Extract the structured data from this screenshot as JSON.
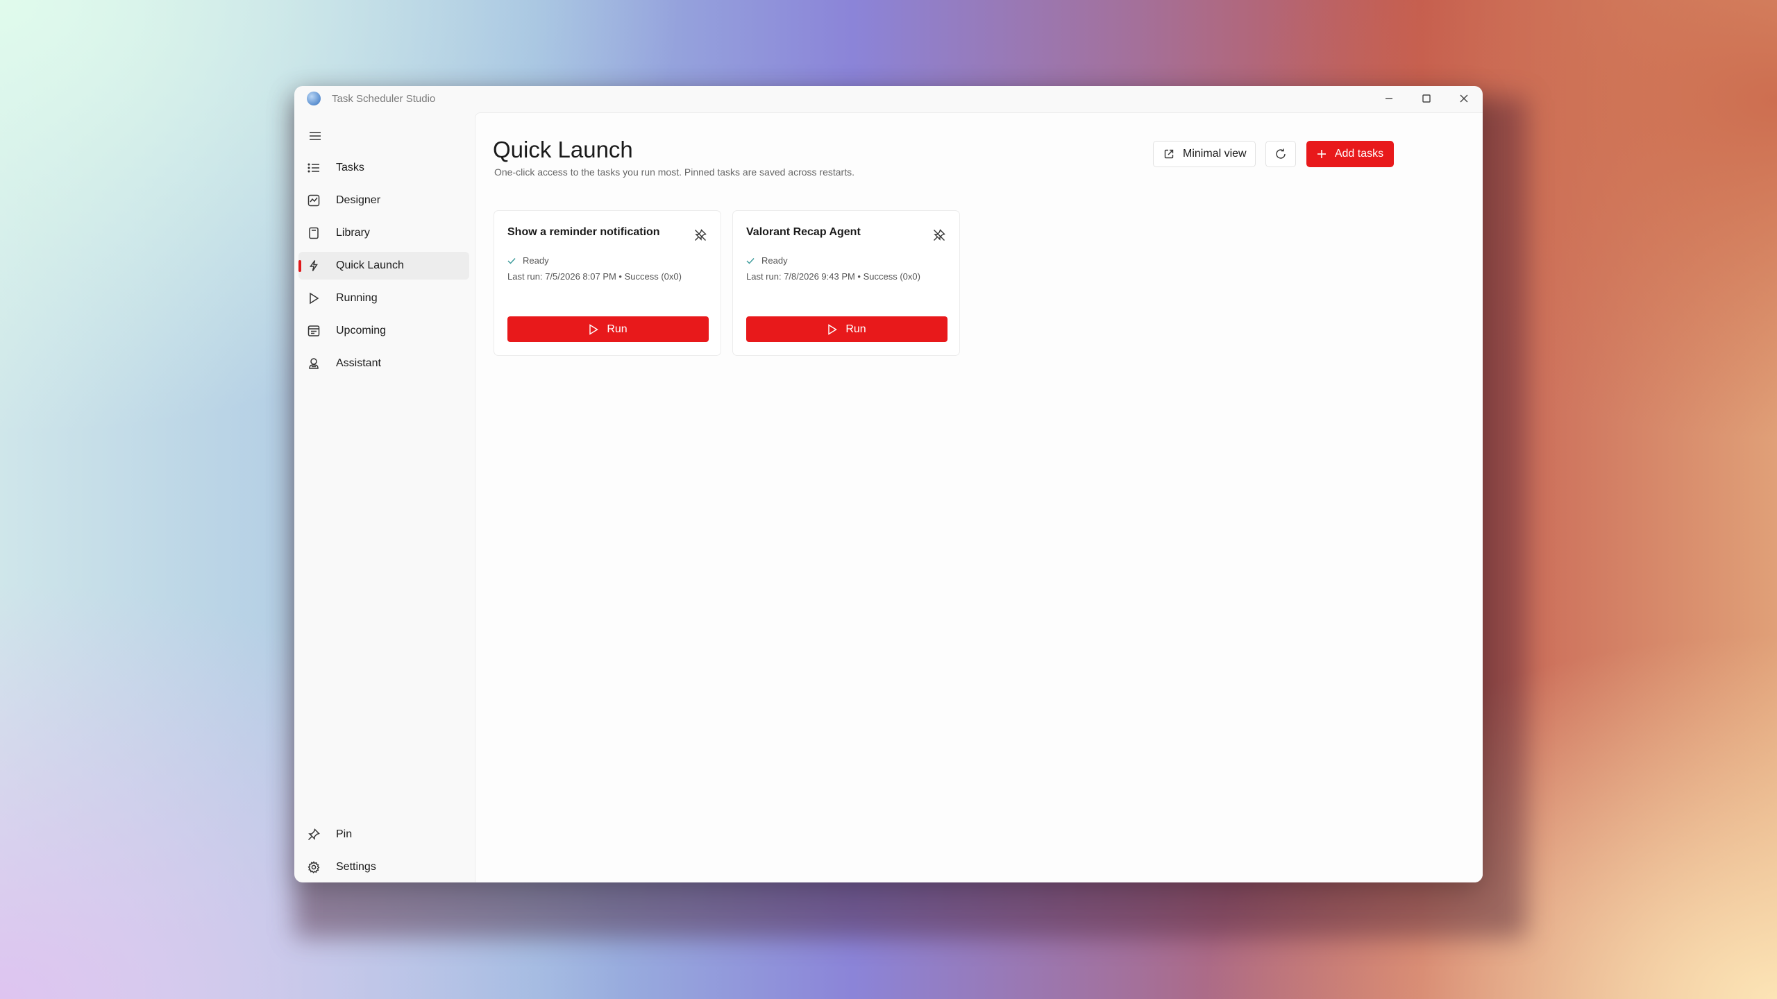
{
  "window": {
    "title": "Task Scheduler Studio"
  },
  "sidebar": {
    "items": [
      {
        "label": "Tasks",
        "icon": "list-icon"
      },
      {
        "label": "Designer",
        "icon": "designer-icon"
      },
      {
        "label": "Library",
        "icon": "library-icon"
      },
      {
        "label": "Quick Launch",
        "icon": "lightning-icon",
        "active": true
      },
      {
        "label": "Running",
        "icon": "play-icon"
      },
      {
        "label": "Upcoming",
        "icon": "calendar-icon"
      },
      {
        "label": "Assistant",
        "icon": "assistant-icon"
      }
    ],
    "footer_items": [
      {
        "label": "Pin",
        "icon": "pin-icon"
      },
      {
        "label": "Settings",
        "icon": "gear-icon"
      }
    ]
  },
  "header": {
    "title": "Quick Launch",
    "subtitle": "One-click access to the tasks you run most. Pinned tasks are saved across restarts.",
    "minimal_view_label": "Minimal view",
    "add_tasks_label": "Add tasks"
  },
  "cards": [
    {
      "title": "Show a reminder notification",
      "status": "Ready",
      "last_run": "Last run: 7/5/2026 8:07 PM • Success (0x0)",
      "run_label": "Run"
    },
    {
      "title": "Valorant Recap Agent",
      "status": "Ready",
      "last_run": "Last run: 7/8/2026 9:43 PM • Success (0x0)",
      "run_label": "Run"
    }
  ],
  "colors": {
    "accent": "#e8191b",
    "status_ready": "#3a9a9a"
  }
}
